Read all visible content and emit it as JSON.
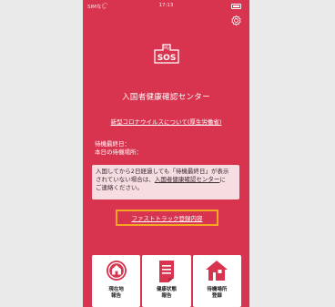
{
  "status_bar": {
    "carrier": "SIMなし",
    "time": "17:13"
  },
  "header": {
    "logo_text": "SOS",
    "logo_small": "My"
  },
  "center": {
    "title": "入国者健康確認センター",
    "covid_link": "新型コロナウイルスについて(厚生労働省)"
  },
  "info": {
    "last_day_label": "待機最終日：",
    "place_label": "本日の待機場所："
  },
  "notice": {
    "line1": "入国してから2日経過しても「待機最終日」が表示",
    "line2_pre": "されていない場合は、",
    "line2_link": "入国者健康確認センター",
    "line2_post": "に",
    "line3": "ご連絡ください。"
  },
  "fasttrack": {
    "label": "ファストトラック登録内容"
  },
  "tiles": [
    {
      "label": "現在地\n報告",
      "icon": "location-icon"
    },
    {
      "label": "健康状態\n報告",
      "icon": "health-report-icon"
    },
    {
      "label": "待機場所\n登録",
      "icon": "house-icon"
    }
  ],
  "colors": {
    "background": "#d8344f",
    "highlight": "#f5a623",
    "notice_bg": "#f6dde2"
  }
}
